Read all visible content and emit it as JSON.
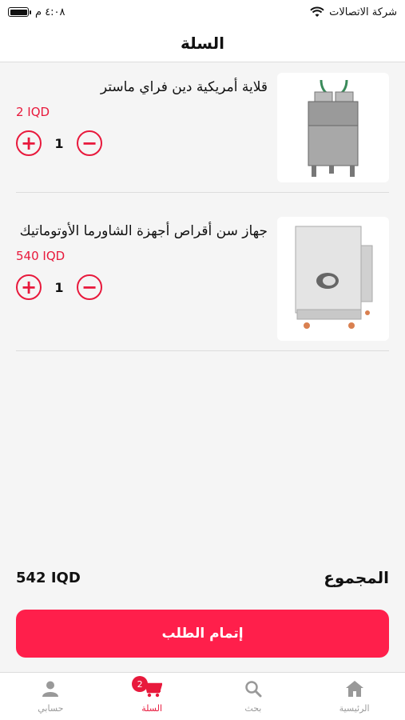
{
  "status_bar": {
    "carrier": "شركة الاتصالات",
    "time": "٤:٠٨ م"
  },
  "header": {
    "title": "السلة"
  },
  "cart": {
    "items": [
      {
        "name": "قلاية أمريكية دين فراي ماستر",
        "price": "2 IQD",
        "quantity": "1",
        "image_icon": "fryer-image"
      },
      {
        "name": "جهاز سن أقراص أجهزة الشاورما الأوتوماتيك",
        "price": "540 IQD",
        "quantity": "1",
        "image_icon": "shawarma-machine-image"
      }
    ]
  },
  "summary": {
    "total_label": "المجموع",
    "total_value": "542 IQD"
  },
  "checkout": {
    "label": "إتمام الطلب"
  },
  "tabbar": {
    "items": [
      {
        "label": "حسابي",
        "icon": "user-icon"
      },
      {
        "label": "السلة",
        "icon": "cart-icon",
        "badge": "2"
      },
      {
        "label": "بحث",
        "icon": "search-icon"
      },
      {
        "label": "الرئيسية",
        "icon": "home-icon"
      }
    ]
  },
  "colors": {
    "accent": "#e8193c",
    "button": "#ff1f4b",
    "inactive": "#999999"
  }
}
